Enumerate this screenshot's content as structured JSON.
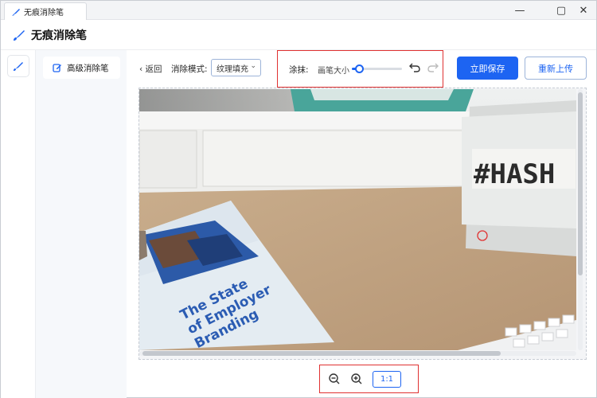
{
  "window": {
    "tab_title": "无痕消除笔",
    "controls": [
      "—",
      "▢",
      "✕"
    ]
  },
  "header": {
    "title": "无痕消除笔"
  },
  "sidebar": {
    "items": [
      {
        "label": "高级消除笔",
        "icon": "edit-icon",
        "active": true
      }
    ]
  },
  "toolbar": {
    "back_label": "‹ 返回",
    "mode_label": "消除模式:",
    "mode_value": "纹理填充",
    "brush": {
      "label": "涂抹:",
      "size_label": "画笔大小",
      "size_level": 0.15
    },
    "save_label": "立即保存",
    "reupload_label": "重新上传"
  },
  "photo": {
    "lightbox_text": "#HASH",
    "booklet_title": [
      "The State",
      "of Employer",
      "Branding"
    ]
  },
  "zoom": {
    "ratio_label": "1:1"
  },
  "colors": {
    "accent": "#1d64f2",
    "highlight": "#e03131"
  }
}
